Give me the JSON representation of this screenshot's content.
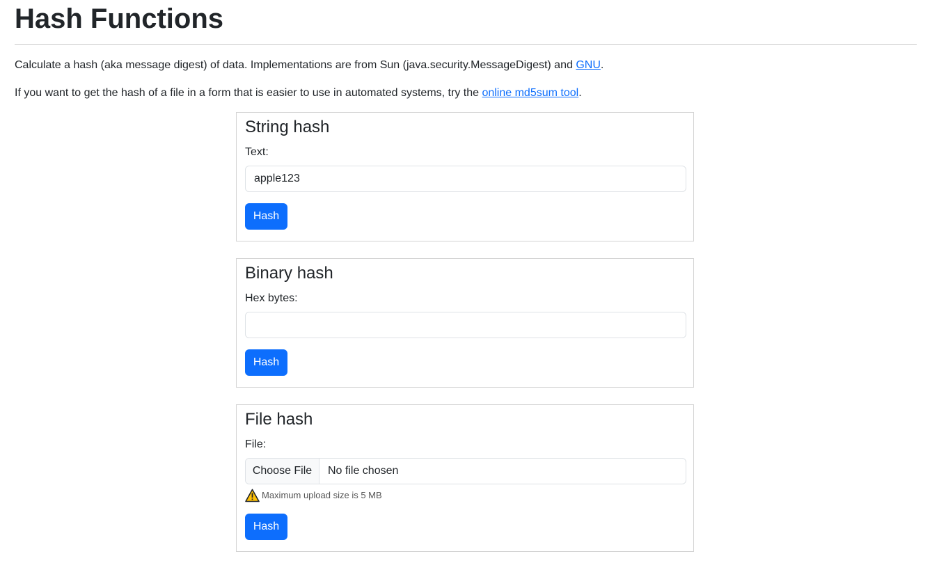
{
  "page": {
    "title": "Hash Functions",
    "intro": {
      "text": "Calculate a hash (aka message digest) of data. Implementations are from Sun (java.security.MessageDigest) and ",
      "link": "GNU",
      "end": "."
    },
    "tool_hint": {
      "text": "If you want to get the hash of a file in a form that is easier to use in automated systems, try the ",
      "link": "online md5sum tool",
      "end": "."
    }
  },
  "string_hash": {
    "title": "String hash",
    "label": "Text:",
    "value": "apple123",
    "button": "Hash"
  },
  "binary_hash": {
    "title": "Binary hash",
    "label": "Hex bytes:",
    "value": "",
    "button": "Hash"
  },
  "file_hash": {
    "title": "File hash",
    "label": "File:",
    "choose_button": "Choose File",
    "status": "No file chosen",
    "note": "Maximum upload size is 5 MB",
    "button": "Hash"
  },
  "colors": {
    "primary": "#0d6efd",
    "link": "#0d6efd",
    "text": "#212529",
    "warning": "#ffc107"
  },
  "icons": {
    "warning": "warning-triangle-icon"
  }
}
